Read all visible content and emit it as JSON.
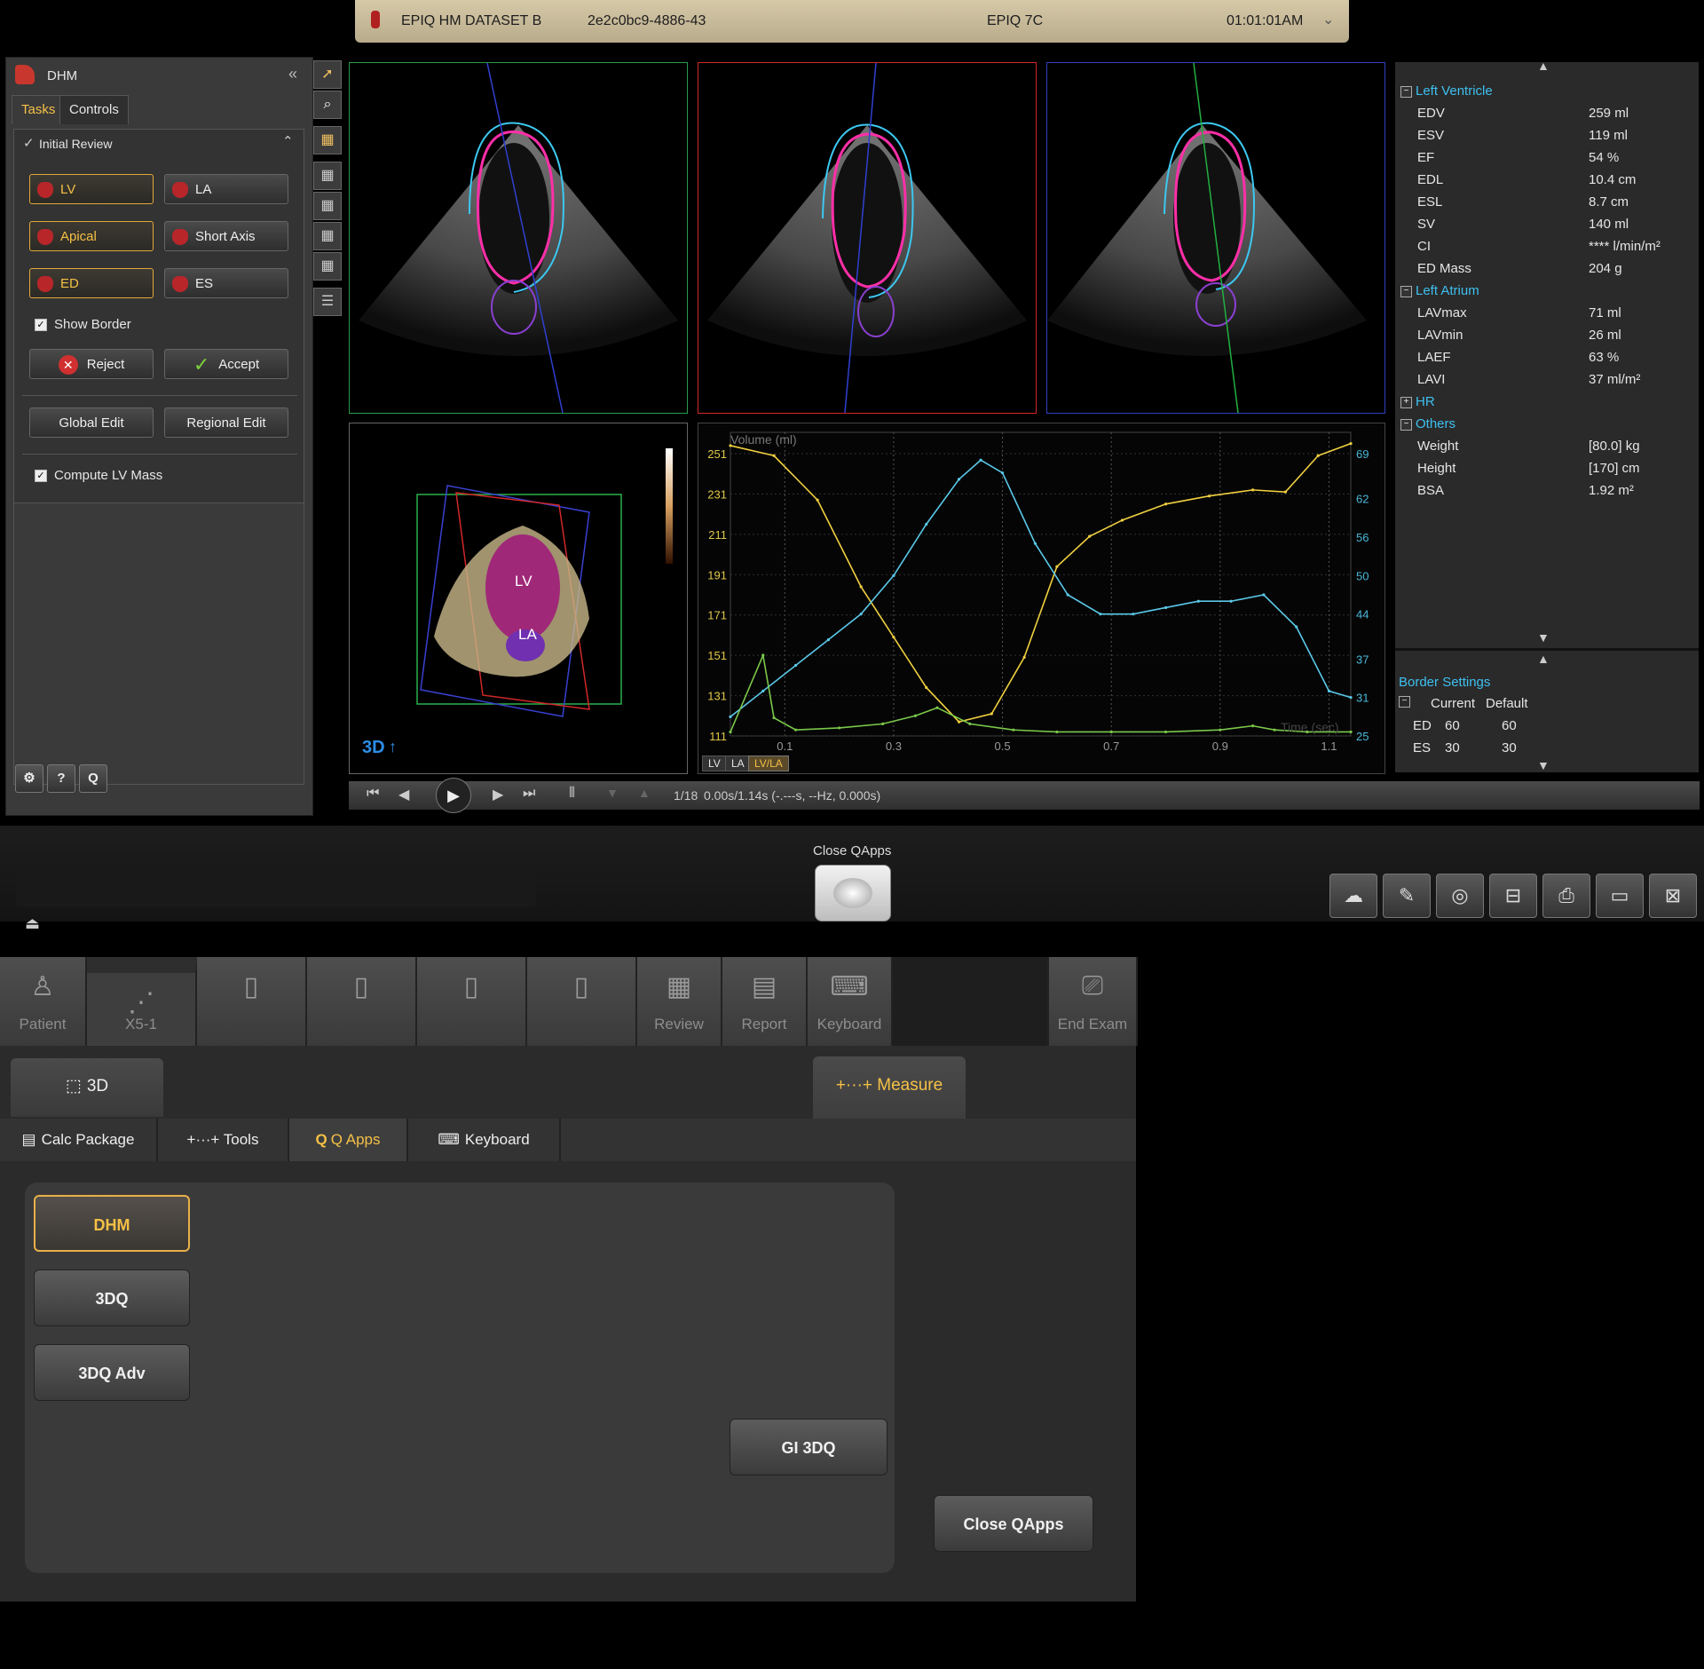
{
  "header": {
    "dataset": "EPIQ HM DATASET B",
    "patient_id": "2e2c0bc9-4886-43",
    "system": "EPIQ 7C",
    "time": "01:01:01AM"
  },
  "left_panel": {
    "app_title": "DHM",
    "tabs": [
      "Tasks",
      "Controls"
    ],
    "section_title": "Initial Review",
    "buttons": {
      "lv": "LV",
      "la": "LA",
      "apical": "Apical",
      "short_axis": "Short Axis",
      "ed": "ED",
      "es": "ES",
      "reject": "Reject",
      "accept": "Accept",
      "global_edit": "Global Edit",
      "regional_edit": "Regional Edit"
    },
    "show_border": "Show Border",
    "compute_lv_mass": "Compute LV Mass",
    "bottom_icons": [
      "gear-icon",
      "help-icon",
      "q-icon"
    ]
  },
  "volume_view": {
    "lv_label": "LV",
    "la_label": "LA",
    "mode_label": "3D"
  },
  "chart_tabs": [
    "LV",
    "LA",
    "LV/LA"
  ],
  "chart_data": {
    "type": "line",
    "ylabel": "Volume (ml)",
    "xlabel": "Time (sec)",
    "xlim": [
      0.0,
      1.14
    ],
    "ylim": [
      111,
      251
    ],
    "y_ticks_left": [
      "251",
      "231",
      "211",
      "191",
      "171",
      "151",
      "131",
      "111"
    ],
    "y_ticks_right": [
      "69",
      "62",
      "56",
      "50",
      "44",
      "37",
      "31",
      "25"
    ],
    "x_ticks": [
      "0.1",
      "0.3",
      "0.5",
      "0.7",
      "0.9",
      "1.1"
    ],
    "series": [
      {
        "color": "#f0d040",
        "axis": "left",
        "x": [
          0.0,
          0.08,
          0.16,
          0.24,
          0.3,
          0.36,
          0.42,
          0.48,
          0.54,
          0.6,
          0.66,
          0.72,
          0.8,
          0.88,
          0.96,
          1.02,
          1.08,
          1.14
        ],
        "y": [
          255,
          250,
          228,
          185,
          160,
          135,
          118,
          122,
          150,
          195,
          210,
          218,
          226,
          230,
          233,
          232,
          250,
          256
        ]
      },
      {
        "color": "#5ac8e8",
        "axis": "right",
        "x": [
          0.0,
          0.06,
          0.12,
          0.18,
          0.24,
          0.3,
          0.36,
          0.42,
          0.46,
          0.5,
          0.56,
          0.62,
          0.68,
          0.74,
          0.8,
          0.86,
          0.92,
          0.98,
          1.04,
          1.1,
          1.14
        ],
        "y": [
          28,
          32,
          36,
          40,
          44,
          50,
          58,
          65,
          68,
          66,
          55,
          47,
          44,
          44,
          45,
          46,
          46,
          47,
          42,
          32,
          31
        ]
      },
      {
        "color": "#7ac84a",
        "axis": "left",
        "x": [
          0.0,
          0.06,
          0.08,
          0.12,
          0.2,
          0.28,
          0.34,
          0.38,
          0.44,
          0.52,
          0.6,
          0.7,
          0.8,
          0.9,
          0.96,
          1.0,
          1.06,
          1.14
        ],
        "y": [
          113,
          151,
          120,
          114,
          115,
          117,
          121,
          125,
          117,
          114,
          113,
          113,
          113,
          114,
          116,
          114,
          113,
          113
        ]
      }
    ]
  },
  "results": {
    "groups": [
      {
        "title": "Left Ventricle",
        "expanded": true,
        "rows": [
          {
            "label": "EDV",
            "value": "259 ml"
          },
          {
            "label": "ESV",
            "value": "119 ml"
          },
          {
            "label": "EF",
            "value": "54 %"
          },
          {
            "label": "EDL",
            "value": "10.4 cm"
          },
          {
            "label": "ESL",
            "value": "8.7 cm"
          },
          {
            "label": "SV",
            "value": "140 ml"
          },
          {
            "label": "CI",
            "value": "**** l/min/m²"
          },
          {
            "label": "ED Mass",
            "value": "204 g"
          }
        ]
      },
      {
        "title": "Left Atrium",
        "expanded": true,
        "rows": [
          {
            "label": "LAVmax",
            "value": "71 ml"
          },
          {
            "label": "LAVmin",
            "value": "26 ml"
          },
          {
            "label": "LAEF",
            "value": "63 %"
          },
          {
            "label": "LAVI",
            "value": "37 ml/m²"
          }
        ]
      },
      {
        "title": "HR",
        "expanded": false,
        "rows": []
      },
      {
        "title": "Others",
        "expanded": true,
        "rows": [
          {
            "label": "Weight",
            "value": "[80.0] kg"
          },
          {
            "label": "Height",
            "value": "[170] cm"
          },
          {
            "label": "BSA",
            "value": "1.92 m²"
          }
        ]
      }
    ],
    "border_settings": {
      "title": "Border Settings",
      "col_current": "Current",
      "col_default": "Default",
      "rows": [
        {
          "label": "ED",
          "current": "60",
          "default": "60"
        },
        {
          "label": "ES",
          "current": "30",
          "default": "30"
        }
      ]
    }
  },
  "playbar": {
    "frame": "1/18",
    "time": "0.00s/1.14s (-.---s, --Hz, 0.000s)"
  },
  "mid": {
    "close_qapps_label": "Close QApps"
  },
  "touch": {
    "top_tabs": [
      {
        "label": "Patient",
        "icon": "person-icon"
      },
      {
        "label": "X5-1",
        "icon": "probe-icon"
      },
      {
        "label": "",
        "icon": "probe-slot-icon"
      },
      {
        "label": "",
        "icon": "probe-slot-icon"
      },
      {
        "label": "",
        "icon": "probe-slot-icon"
      },
      {
        "label": "",
        "icon": "probe-slot-icon"
      },
      {
        "label": "Review",
        "icon": "grid-icon"
      },
      {
        "label": "Report",
        "icon": "document-icon"
      },
      {
        "label": "Keyboard",
        "icon": "keyboard-icon"
      },
      {
        "label": "",
        "icon": ""
      },
      {
        "label": "End Exam",
        "icon": "folder-icon"
      }
    ],
    "mode_3d": "3D",
    "measure": "+···+ Measure",
    "sub_tabs": [
      "Calc Package",
      "+···+ Tools",
      "Q Apps",
      "Keyboard"
    ],
    "qapps": [
      "DHM",
      "3DQ",
      "3DQ Adv"
    ],
    "gi_3dq": "GI 3DQ",
    "close_qapps": "Close QApps"
  }
}
